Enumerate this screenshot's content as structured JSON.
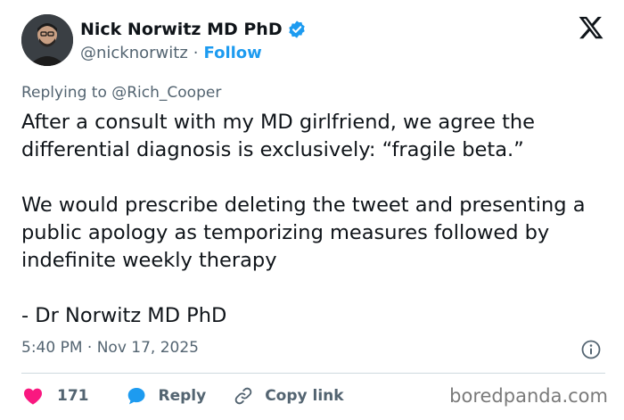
{
  "author": {
    "display_name": "Nick Norwitz MD PhD",
    "handle": "@nicknorwitz",
    "separator": "·",
    "follow_label": "Follow",
    "verified": true
  },
  "reply_context": {
    "prefix": "Replying to",
    "mention": "@Rich_Cooper"
  },
  "tweet": {
    "paragraphs": [
      "After a consult with my MD girlfriend, we agree the differential diagnosis is exclusively: “fragile beta.”",
      "We would prescribe deleting the tweet and presenting a public apology as temporizing measures followed by indefinite weekly therapy",
      "- Dr Norwitz MD PhD"
    ],
    "timestamp": "5:40 PM · Nov 17, 2025"
  },
  "actions": {
    "like_count": "171",
    "reply_label": "Reply",
    "copy_link_label": "Copy link"
  },
  "watermark": "boredpanda.com",
  "colors": {
    "accent": "#1d9bf0",
    "like": "#f91880",
    "secondary_text": "#536471",
    "primary_text": "#0f1419"
  },
  "icons": [
    "verified-badge-icon",
    "x-logo-icon",
    "info-icon",
    "heart-icon",
    "reply-bubble-icon",
    "link-icon"
  ]
}
